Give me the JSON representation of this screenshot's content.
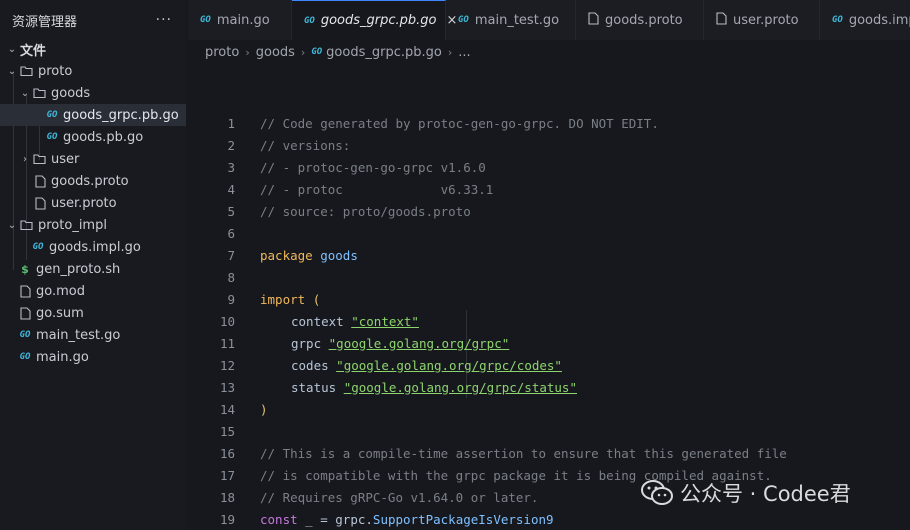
{
  "sidebar": {
    "title": "资源管理器",
    "more": "···",
    "items": [
      {
        "label": "文件",
        "chev": "⌄",
        "kind": "root"
      },
      {
        "label": "proto",
        "chev": "⌄",
        "kind": "folder-open"
      },
      {
        "label": "goods",
        "chev": "⌄",
        "kind": "folder-open"
      },
      {
        "label": "goods_grpc.pb.go",
        "kind": "go"
      },
      {
        "label": "goods.pb.go",
        "kind": "go"
      },
      {
        "label": "user",
        "chev": "›",
        "kind": "folder"
      },
      {
        "label": "goods.proto",
        "kind": "file"
      },
      {
        "label": "user.proto",
        "kind": "file"
      },
      {
        "label": "proto_impl",
        "chev": "⌄",
        "kind": "folder-open"
      },
      {
        "label": "goods.impl.go",
        "kind": "go"
      },
      {
        "label": "gen_proto.sh",
        "kind": "shell"
      },
      {
        "label": "go.mod",
        "kind": "file"
      },
      {
        "label": "go.sum",
        "kind": "file"
      },
      {
        "label": "main_test.go",
        "kind": "go"
      },
      {
        "label": "main.go",
        "kind": "go"
      }
    ]
  },
  "tabs": [
    {
      "label": "main.go",
      "icon": "go-icon"
    },
    {
      "label": "goods_grpc.pb.go",
      "icon": "go-icon",
      "active": true,
      "close": "×"
    },
    {
      "label": "main_test.go",
      "icon": "go-icon"
    },
    {
      "label": "goods.proto",
      "icon": "file-icon"
    },
    {
      "label": "user.proto",
      "icon": "file-icon"
    },
    {
      "label": "goods.impl",
      "icon": "go-icon"
    }
  ],
  "breadcrumb": {
    "parts": [
      "proto",
      "goods",
      "goods_grpc.pb.go",
      "..."
    ],
    "sep": "›"
  },
  "editor": {
    "line_numbers": [
      "1",
      "2",
      "3",
      "4",
      "5",
      "6",
      "7",
      "8",
      "9",
      "10",
      "11",
      "12",
      "13",
      "14",
      "15",
      "16",
      "17",
      "18",
      "19"
    ],
    "lines": {
      "l1": "// Code generated by protoc-gen-go-grpc. DO NOT EDIT.",
      "l2": "// versions:",
      "l3": "// - protoc-gen-go-grpc v1.6.0",
      "l4": "// - protoc             v6.33.1",
      "l5": "// source: proto/goods.proto",
      "l7_kw": "package",
      "l7_id": "goods",
      "l9_kw": "import",
      "l9_paren": "(",
      "l10_id": "context",
      "l10_str": "\"context\"",
      "l11_id": "grpc",
      "l11_str": "\"google.golang.org/grpc\"",
      "l12_id": "codes",
      "l12_str": "\"google.golang.org/grpc/codes\"",
      "l13_id": "status",
      "l13_str": "\"google.golang.org/grpc/status\"",
      "l14_paren": ")",
      "l16": "// This is a compile-time assertion to ensure that this generated file",
      "l17": "// is compatible with the grpc package it is being compiled against.",
      "l18": "// Requires gRPC-Go v1.64.0 or later.",
      "l19_kw": "const",
      "l19_mid": " _ = ",
      "l19_pkg": "grpc",
      "l19_dot": ".",
      "l19_fn": "SupportPackageIsVersion9"
    }
  },
  "watermark": {
    "text": "公众号 · Codee君"
  },
  "colors": {
    "accent": "#3f87ff",
    "go_icon": "#3fb7d8",
    "string": "#8ed46e",
    "keyword": "#f0b85c",
    "comment": "#7a7f87"
  }
}
